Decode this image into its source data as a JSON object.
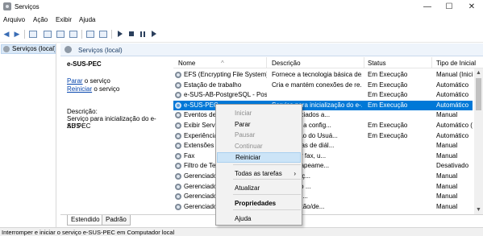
{
  "window": {
    "title": "Serviços",
    "minimize": "—",
    "maximize": "☐",
    "close": "✕"
  },
  "menubar": [
    "Arquivo",
    "Ação",
    "Exibir",
    "Ajuda"
  ],
  "tree": {
    "selected": "Serviços (local)"
  },
  "pane": {
    "header": "Serviços (local)"
  },
  "detail": {
    "service_name": "e-SUS-PEC",
    "link_stop": "Parar",
    "link_stop_suffix": " o serviço",
    "link_restart": "Reiniciar",
    "link_restart_suffix": " o serviço",
    "desc_label": "Descrição:",
    "desc_line1": "Serviço para inicialização do e-SUS-",
    "desc_line2": "AB PEC"
  },
  "columns": {
    "name": "Nome",
    "description": "Descrição",
    "status": "Status",
    "startup": "Tipo de Inicial"
  },
  "rows": [
    {
      "name": "EFS (Encrypting File System)",
      "description": "Fornece a tecnologia básica de...",
      "status": "Em Execução",
      "startup": "Manual (Iniciar"
    },
    {
      "name": "Estação de trabalho",
      "description": "Cria e mantém conexões de re...",
      "status": "Em Execução",
      "startup": "Automático"
    },
    {
      "name": "e-SUS-AB-PostgreSQL - Pos...",
      "description": "",
      "status": "Em Execução",
      "startup": "Automático"
    },
    {
      "name": "e-SUS-PEC",
      "description": "Serviço para inicialização do e-...",
      "status": "Em Execução",
      "startup": "Automático",
      "selected": true
    },
    {
      "name": "Eventos de",
      "description": "tivos associados a...",
      "status": "",
      "startup": "Manual"
    },
    {
      "name": "Exibir Servi",
      "description": "conexão e a config...",
      "status": "Em Execução",
      "startup": "Automático (A"
    },
    {
      "name": "Experiência",
      "description": "inicialização do Usuá...",
      "status": "Em Execução",
      "startup": "Automático"
    },
    {
      "name": "Extensões",
      "description": "sobre caixas de diál...",
      "status": "",
      "startup": "Manual"
    },
    {
      "name": "Fax",
      "description": "r e receber fax, u...",
      "status": "",
      "startup": "Manual"
    },
    {
      "name": "Filtro de Te",
      "description": "agem e mapeame...",
      "status": "",
      "startup": "Desativado"
    },
    {
      "name": "Gerenciado",
      "description": "r autenticaç...",
      "status": "",
      "startup": "Manual"
    },
    {
      "name": "Gerenciado",
      "description": "e conteúdo ...",
      "status": "",
      "startup": "Manual"
    },
    {
      "name": "Gerenciado",
      "description": "om uma re...",
      "status": "",
      "startup": "Manual"
    },
    {
      "name": "Gerenciado",
      "description": "s de conexão/de...",
      "status": "",
      "startup": "Manual"
    }
  ],
  "tabs": [
    "Estendido",
    "Padrão"
  ],
  "status_text": "Interromper e iniciar o serviço e-SUS-PEC em Computador local",
  "context_menu": {
    "items": [
      {
        "label": "Iniciar",
        "disabled": true
      },
      {
        "label": "Parar"
      },
      {
        "label": "Pausar",
        "disabled": true
      },
      {
        "label": "Continuar",
        "disabled": true
      },
      {
        "label": "Reiniciar",
        "highlighted": true
      },
      {
        "label": "Todas as tarefas",
        "submenu": "›"
      },
      {
        "label": "Atualizar"
      },
      {
        "label": "Propriedades",
        "bold": true
      },
      {
        "label": "Ajuda"
      }
    ]
  },
  "colors": {
    "selection": "#0078d7",
    "link": "#0645ad",
    "menu_highlight": "#cce4f7"
  }
}
